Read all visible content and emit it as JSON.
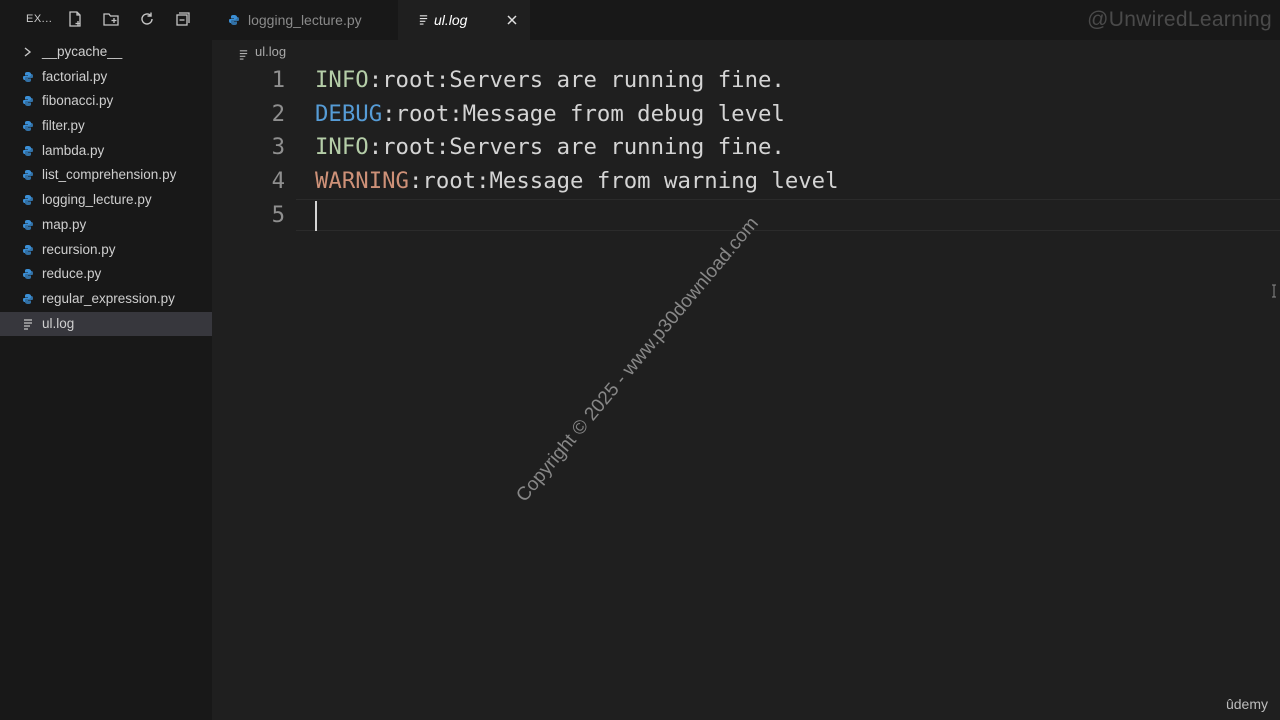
{
  "explorer": {
    "title": "EX...",
    "files": [
      {
        "label": "__pycache__",
        "type": "folder"
      },
      {
        "label": "factorial.py",
        "type": "python"
      },
      {
        "label": "fibonacci.py",
        "type": "python"
      },
      {
        "label": "filter.py",
        "type": "python"
      },
      {
        "label": "lambda.py",
        "type": "python"
      },
      {
        "label": "list_comprehension.py",
        "type": "python"
      },
      {
        "label": "logging_lecture.py",
        "type": "python"
      },
      {
        "label": "map.py",
        "type": "python"
      },
      {
        "label": "recursion.py",
        "type": "python"
      },
      {
        "label": "reduce.py",
        "type": "python"
      },
      {
        "label": "regular_expression.py",
        "type": "python"
      },
      {
        "label": "ul.log",
        "type": "log",
        "active": true
      }
    ]
  },
  "tabs": [
    {
      "label": "logging_lecture.py",
      "active": false
    },
    {
      "label": "ul.log",
      "active": true
    }
  ],
  "breadcrumb": {
    "file": "ul.log"
  },
  "editor": {
    "lines": [
      {
        "num": "1",
        "level": "INFO",
        "rest": ":root:Servers are running fine."
      },
      {
        "num": "2",
        "level": "DEBUG",
        "rest": ":root:Message from debug level"
      },
      {
        "num": "3",
        "level": "INFO",
        "rest": ":root:Servers are running fine."
      },
      {
        "num": "4",
        "level": "WARNING",
        "rest": ":root:Message from warning level"
      },
      {
        "num": "5",
        "level": "",
        "rest": ""
      }
    ]
  },
  "overlays": {
    "channel": "@UnwiredLearning",
    "copyright": "Copyright © 2025 - www.p30download.com",
    "brand": "ûdemy"
  },
  "colors": {
    "info": "#b5cea8",
    "debug": "#569cd6",
    "warning": "#ce9178",
    "python_icon": "#3b8fd6"
  }
}
